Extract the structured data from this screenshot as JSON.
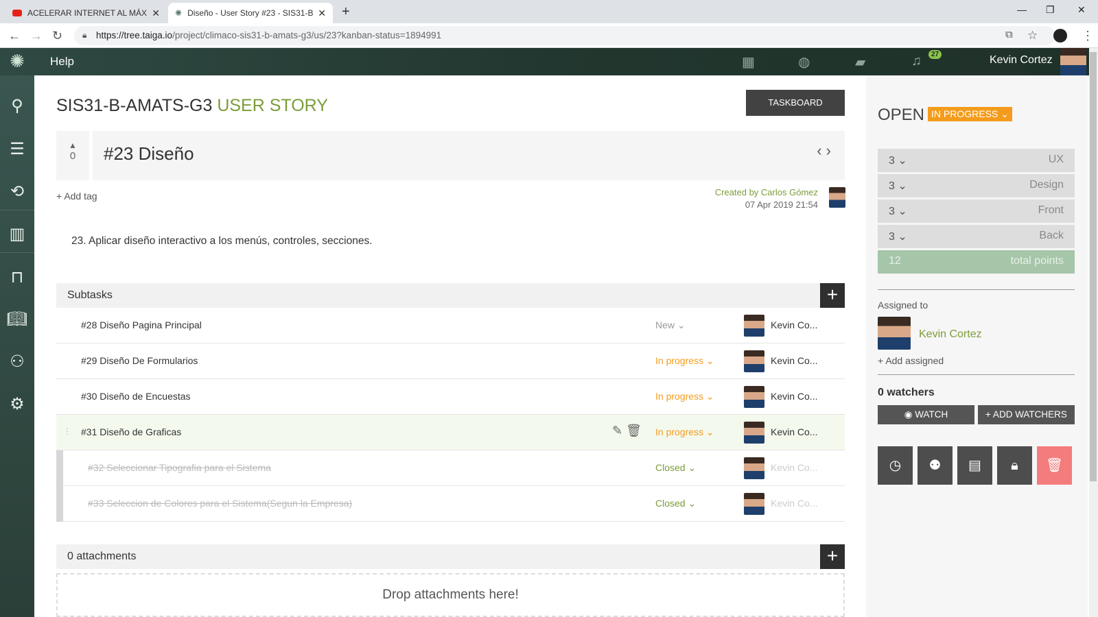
{
  "browser": {
    "tabs": [
      {
        "title": "ACELERAR INTERNET AL MÁXIMO"
      },
      {
        "title": "Diseño - User Story #23 - SIS31-B-"
      }
    ],
    "url_host": "https://tree.taiga.io",
    "url_path": "/project/climaco-sis31-b-amats-g3/us/23?kanban-status=1894991"
  },
  "header": {
    "help": "Help",
    "notification_count": "27",
    "user_name": "Kevin Cortez"
  },
  "page": {
    "project": "SIS31-B-AMATS-G3",
    "section": "USER STORY",
    "taskboard_label": "TASKBOARD",
    "votes": "0",
    "story_title": "#23 Diseño",
    "add_tag": "Add tag",
    "created_by": "Created by Carlos Gómez",
    "created_date": "07 Apr 2019 21:54",
    "description": "23. Aplicar diseño interactivo a los menús, controles, secciones."
  },
  "subtasks": {
    "header": "Subtasks",
    "items": [
      {
        "ref": "#28 Diseño Pagina Principal",
        "status": "New",
        "assignee": "Kevin Co..."
      },
      {
        "ref": "#29 Diseño De Formularios",
        "status": "In progress",
        "assignee": "Kevin Co..."
      },
      {
        "ref": "#30 Diseño de Encuestas",
        "status": "In progress",
        "assignee": "Kevin Co..."
      },
      {
        "ref": "#31 Diseño de Graficas",
        "status": "In progress",
        "assignee": "Kevin Co..."
      },
      {
        "ref": "#32 Seleccionar Tipografia para el Sistema",
        "status": "Closed",
        "assignee": "Kevin Co..."
      },
      {
        "ref": "#33 Seleccion de Colores para el Sistema(Segun la Empresa)",
        "status": "Closed",
        "assignee": "Kevin Co..."
      }
    ]
  },
  "attachments": {
    "header": "0 attachments",
    "drop": "Drop attachments here!"
  },
  "sidebar_right": {
    "open": "OPEN",
    "status": "IN PROGRESS",
    "points": [
      {
        "value": "3",
        "role": "UX"
      },
      {
        "value": "3",
        "role": "Design"
      },
      {
        "value": "3",
        "role": "Front"
      },
      {
        "value": "3",
        "role": "Back"
      }
    ],
    "total_value": "12",
    "total_label": "total points",
    "assigned_label": "Assigned to",
    "assignee": "Kevin Cortez",
    "add_assigned": "Add assigned",
    "watchers": "0 watchers",
    "watch": "WATCH",
    "add_watchers": "+ ADD WATCHERS"
  },
  "colors": {
    "accent_green": "#7c9c39",
    "in_progress": "#f59b1b",
    "delete": "#f47c7c"
  }
}
